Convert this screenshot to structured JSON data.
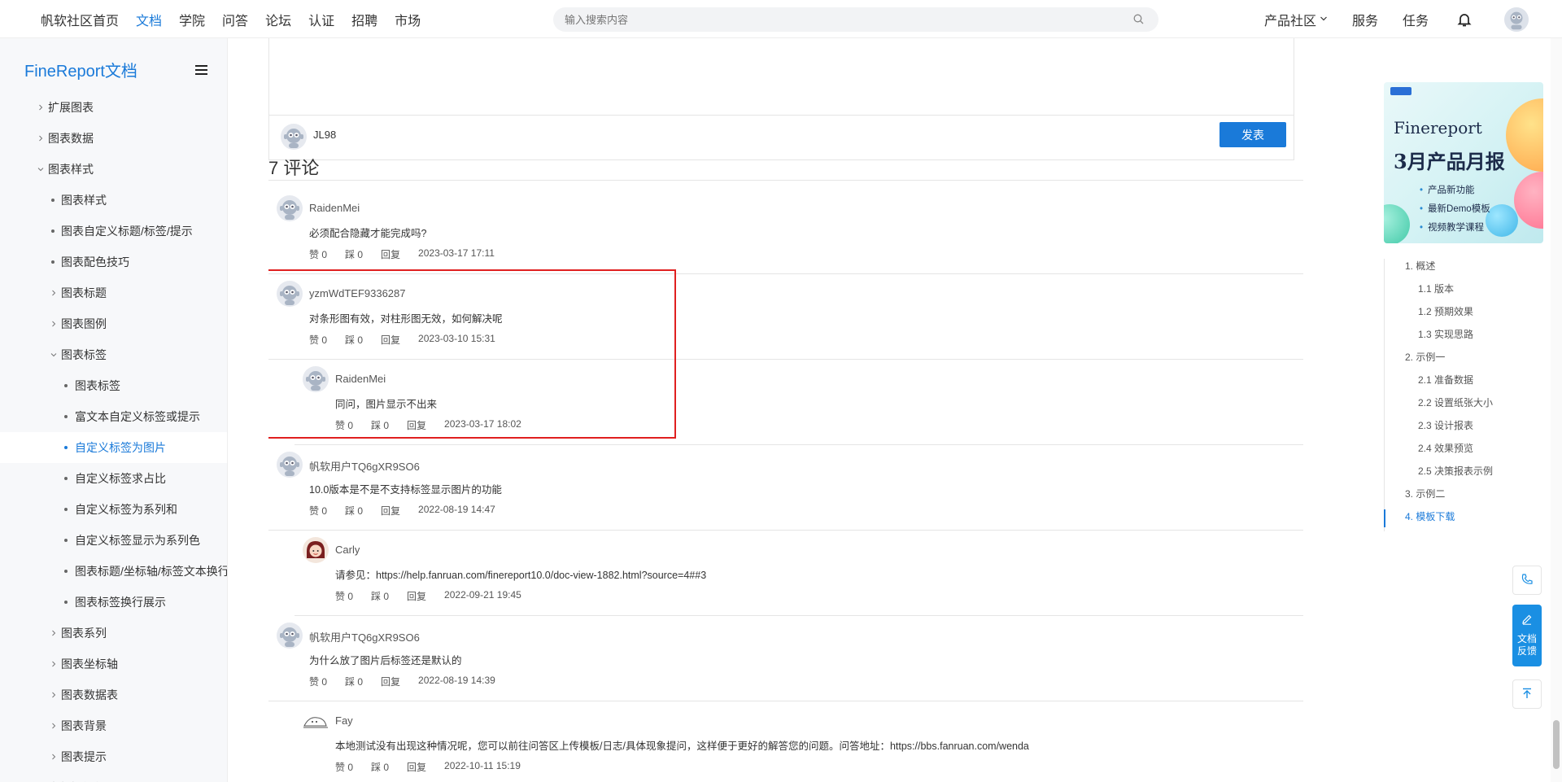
{
  "nav": {
    "links": [
      "帆软社区首页",
      "文档",
      "学院",
      "问答",
      "论坛",
      "认证",
      "招聘",
      "市场"
    ],
    "active_index": 1,
    "search_placeholder": "输入搜索内容",
    "right_links": [
      "产品社区",
      "服务",
      "任务"
    ]
  },
  "sidebar": {
    "brand": "FineReport文档",
    "items": [
      {
        "label": "扩展图表",
        "kind": "folder",
        "level": 0
      },
      {
        "label": "图表数据",
        "kind": "folder",
        "level": 0
      },
      {
        "label": "图表样式",
        "kind": "open",
        "level": 0
      },
      {
        "label": "图表样式",
        "kind": "doc",
        "level": 1
      },
      {
        "label": "图表自定义标题/标签/提示",
        "kind": "doc",
        "level": 1
      },
      {
        "label": "图表配色技巧",
        "kind": "doc",
        "level": 1
      },
      {
        "label": "图表标题",
        "kind": "folder",
        "level": 1
      },
      {
        "label": "图表图例",
        "kind": "folder",
        "level": 1
      },
      {
        "label": "图表标签",
        "kind": "open",
        "level": 1
      },
      {
        "label": "图表标签",
        "kind": "doc",
        "level": 2
      },
      {
        "label": "富文本自定义标签或提示",
        "kind": "doc",
        "level": 2
      },
      {
        "label": "自定义标签为图片",
        "kind": "doc",
        "level": 2,
        "active": true
      },
      {
        "label": "自定义标签求占比",
        "kind": "doc",
        "level": 2
      },
      {
        "label": "自定义标签为系列和",
        "kind": "doc",
        "level": 2
      },
      {
        "label": "自定义标签显示为系列色",
        "kind": "doc",
        "level": 2
      },
      {
        "label": "图表标题/坐标轴/标签文本换行",
        "kind": "doc",
        "level": 2
      },
      {
        "label": "图表标签换行展示",
        "kind": "doc",
        "level": 2
      },
      {
        "label": "图表系列",
        "kind": "folder",
        "level": 1
      },
      {
        "label": "图表坐标轴",
        "kind": "folder",
        "level": 1
      },
      {
        "label": "图表数据表",
        "kind": "folder",
        "level": 1
      },
      {
        "label": "图表背景",
        "kind": "folder",
        "level": 1
      },
      {
        "label": "图表提示",
        "kind": "folder",
        "level": 1
      },
      {
        "label": "大数据优化",
        "kind": "folder",
        "level": 0
      }
    ]
  },
  "editor": {
    "username": "JL98",
    "post_label": "发表"
  },
  "comments_title": "7 评论",
  "comments": [
    {
      "user": "RaidenMei",
      "text": "必须配合隐藏才能完成吗?",
      "like": "赞 0",
      "dislike": "踩 0",
      "reply": "回复",
      "time": "2023-03-17 17:11",
      "reply_level": 0,
      "avatar": "robot"
    },
    {
      "user": "yzmWdTEF9336287",
      "text": "对条形图有效，对柱形图无效，如何解决呢",
      "like": "赞 0",
      "dislike": "踩 0",
      "reply": "回复",
      "time": "2023-03-10 15:31",
      "reply_level": 0,
      "avatar": "robot"
    },
    {
      "user": "RaidenMei",
      "text": "同问，图片显示不出来",
      "like": "赞 0",
      "dislike": "踩 0",
      "reply": "回复",
      "time": "2023-03-17 18:02",
      "reply_level": 1,
      "avatar": "robot"
    },
    {
      "user": "帆软用户TQ6gXR9SO6",
      "text": "10.0版本是不是不支持标签显示图片的功能",
      "like": "赞 0",
      "dislike": "踩 0",
      "reply": "回复",
      "time": "2022-08-19 14:47",
      "reply_level": 0,
      "avatar": "robot"
    },
    {
      "user": "Carly",
      "text": "请参见：https://help.fanruan.com/finereport10.0/doc-view-1882.html?source=4##3",
      "like": "赞 0",
      "dislike": "踩 0",
      "reply": "回复",
      "time": "2022-09-21 19:45",
      "reply_level": 1,
      "avatar": "girl"
    },
    {
      "user": "帆软用户TQ6gXR9SO6",
      "text": "为什么放了图片后标签还是默认的",
      "like": "赞 0",
      "dislike": "踩 0",
      "reply": "回复",
      "time": "2022-08-19 14:39",
      "reply_level": 0,
      "avatar": "robot"
    },
    {
      "user": "Fay",
      "text": "本地测试没有出现这种情况呢，您可以前往问答区上传模板/日志/具体现象提问，这样便于更好的解答您的问题。问答地址：https://bbs.fanruan.com/wenda",
      "like": "赞 0",
      "dislike": "踩 0",
      "reply": "回复",
      "time": "2022-10-11 15:19",
      "reply_level": 1,
      "avatar": "seal"
    }
  ],
  "banner": {
    "line1": "Finereport",
    "line2": "3月产品月报",
    "bullets": [
      "产品新功能",
      "最新Demo模板",
      "视频教学课程"
    ]
  },
  "toc": [
    {
      "label": "1. 概述",
      "level": 0
    },
    {
      "label": "1.1 版本",
      "level": 1
    },
    {
      "label": "1.2 预期效果",
      "level": 1
    },
    {
      "label": "1.3 实现思路",
      "level": 1
    },
    {
      "label": "2. 示例一",
      "level": 0
    },
    {
      "label": "2.1 准备数据",
      "level": 1
    },
    {
      "label": "2.2 设置纸张大小",
      "level": 1
    },
    {
      "label": "2.3 设计报表",
      "level": 1
    },
    {
      "label": "2.4 效果预览",
      "level": 1
    },
    {
      "label": "2.5 决策报表示例",
      "level": 1
    },
    {
      "label": "3. 示例二",
      "level": 0
    },
    {
      "label": "4. 模板下载",
      "level": 0,
      "active": true
    }
  ],
  "fab": {
    "feedback_label_1": "文档",
    "feedback_label_2": "反馈"
  },
  "colors": {
    "accent": "#1a7ad9",
    "highlight_border": "#e02020"
  }
}
